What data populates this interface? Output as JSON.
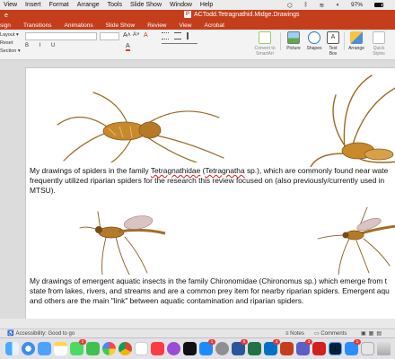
{
  "menubar": {
    "items": [
      "View",
      "Insert",
      "Format",
      "Arrange",
      "Tools",
      "Slide Show",
      "Window",
      "Help"
    ],
    "battery": "97%"
  },
  "titlebar": {
    "doc_title": "ACTodd.Tetragnathid.Midge.Drawings",
    "left_mark": "e"
  },
  "tabs": [
    "sign",
    "Transitions",
    "Animations",
    "Slide Show",
    "Review",
    "View",
    "Acrobat"
  ],
  "ribbon": {
    "left_items": [
      "Layout",
      "Reset",
      "Section"
    ],
    "convert_label": "Convert to SmartArt",
    "picture_label": "Picture",
    "shapes_label": "Shapes",
    "textbox_label": "Text Box",
    "arrange_label": "Arrange",
    "quick_styles_label": "Quick Styles"
  },
  "slide": {
    "paragraph1": {
      "before": "My drawings of spiders in the family ",
      "genus": "Tetragnathidae",
      "middle": " (",
      "species": "Tetragnatha",
      "after": " sp.), which are commonly found near wate",
      "line2": "frequently utilized riparian spiders for the research this review focused on (also previously/currently used in",
      "line3": "MTSU)."
    },
    "paragraph2": {
      "line1": "My drawings of emergent aquatic insects in the family Chironomidae (Chironomus sp.) which emerge from t",
      "line2": "state from lakes, rivers, and streams and are a common prey item for nearby riparian spiders. Emergent aqu",
      "line3": "and others are the main \"link\" between aquatic contamination and riparian spiders."
    }
  },
  "statusbar": {
    "accessibility": "Accessibility: Good to go",
    "notes": "Notes",
    "comments": "Comments"
  },
  "dock": {
    "badges": [
      "2",
      "1",
      "6",
      "4",
      "3",
      "1"
    ]
  },
  "colors": {
    "accent": "#c43e1c",
    "spider_body": "#c8892c",
    "midge_wing": "#d9c3c3"
  }
}
